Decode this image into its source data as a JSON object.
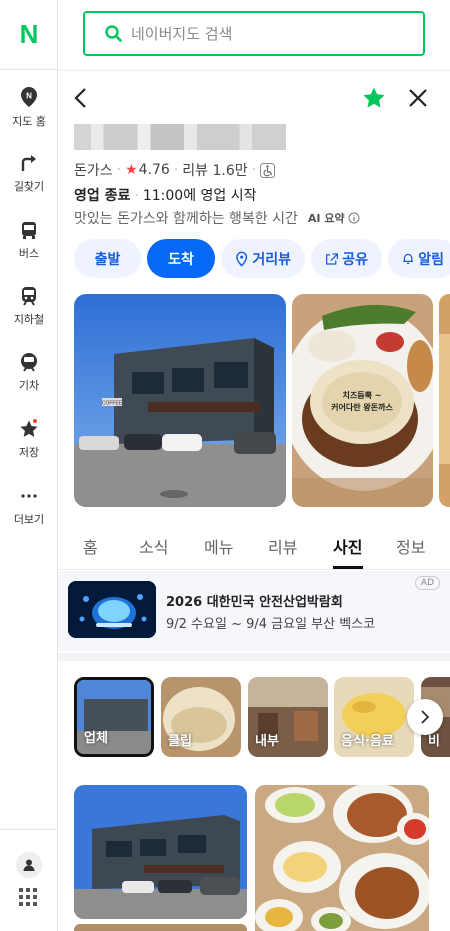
{
  "sidebar": {
    "logo": "N",
    "items": [
      {
        "label": "지도 홈",
        "icon": "map-pin-icon"
      },
      {
        "label": "길찾기",
        "icon": "directions-icon"
      },
      {
        "label": "버스",
        "icon": "bus-icon"
      },
      {
        "label": "지하철",
        "icon": "subway-icon"
      },
      {
        "label": "기차",
        "icon": "train-icon"
      },
      {
        "label": "저장",
        "icon": "star-icon"
      },
      {
        "label": "더보기",
        "icon": "more-icon"
      }
    ]
  },
  "search": {
    "placeholder": "네이버지도 검색"
  },
  "place": {
    "category": "돈가스",
    "rating": "4.76",
    "reviews": "리뷰 1.6만",
    "status": "영업 종료",
    "hours": "11:00에 영업 시작",
    "description": "맛있는 돈가스와 함께하는 행복한 시간",
    "ai_label": "AI 요약"
  },
  "actions": {
    "depart": "출발",
    "arrive": "도착",
    "street": "거리뷰",
    "share": "공유",
    "alert": "알림"
  },
  "photos": {
    "food_caption_1": "치즈듬뿍 ~",
    "food_caption_2": "커어다란 왕돈까스",
    "building_sign": "COFFEE"
  },
  "tabs": [
    "홈",
    "소식",
    "메뉴",
    "리뷰",
    "사진",
    "정보"
  ],
  "active_tab": "사진",
  "ad": {
    "badge": "AD",
    "title": "2026 대한민국 안전산업박람회",
    "subtitle": "9/2 수요일 ~ 9/4 금요일 부산 벡스코"
  },
  "categories": [
    "업체",
    "클립",
    "내부",
    "음식·음료",
    "비"
  ],
  "colors": {
    "brand": "#03c75a",
    "primary": "#0568f6",
    "star": "#ff4343"
  }
}
